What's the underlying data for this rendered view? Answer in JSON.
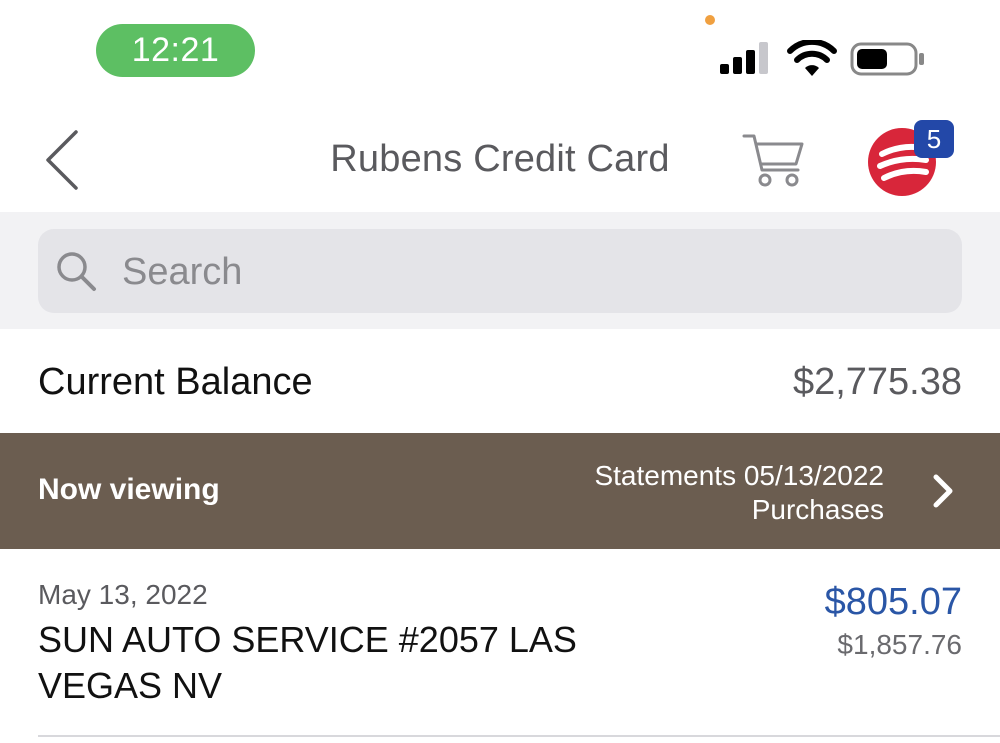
{
  "status_bar": {
    "time": "12:21",
    "icons": [
      "signal-icon",
      "wifi-icon",
      "battery-icon"
    ]
  },
  "nav": {
    "title": "Rubens Credit Card",
    "back_icon": "chevron-left-icon",
    "cart_icon": "cart-icon",
    "notification_count": "5"
  },
  "search": {
    "placeholder": "Search"
  },
  "balance": {
    "label": "Current Balance",
    "value": "$2,775.38"
  },
  "viewing": {
    "label": "Now viewing",
    "line1": "Statements 05/13/2022",
    "line2": "Purchases"
  },
  "transactions": [
    {
      "date": "May 13, 2022",
      "merchant": "SUN AUTO SERVICE #2057 LAS VEGAS NV",
      "amount": "$805.07",
      "running_balance": "$1,857.76"
    }
  ],
  "colors": {
    "time_pill": "#5dbf63",
    "viewing_bar": "#6b5d50",
    "amount_blue": "#2a56a6",
    "logo_red": "#d8263a",
    "badge_blue": "#2348a8"
  }
}
